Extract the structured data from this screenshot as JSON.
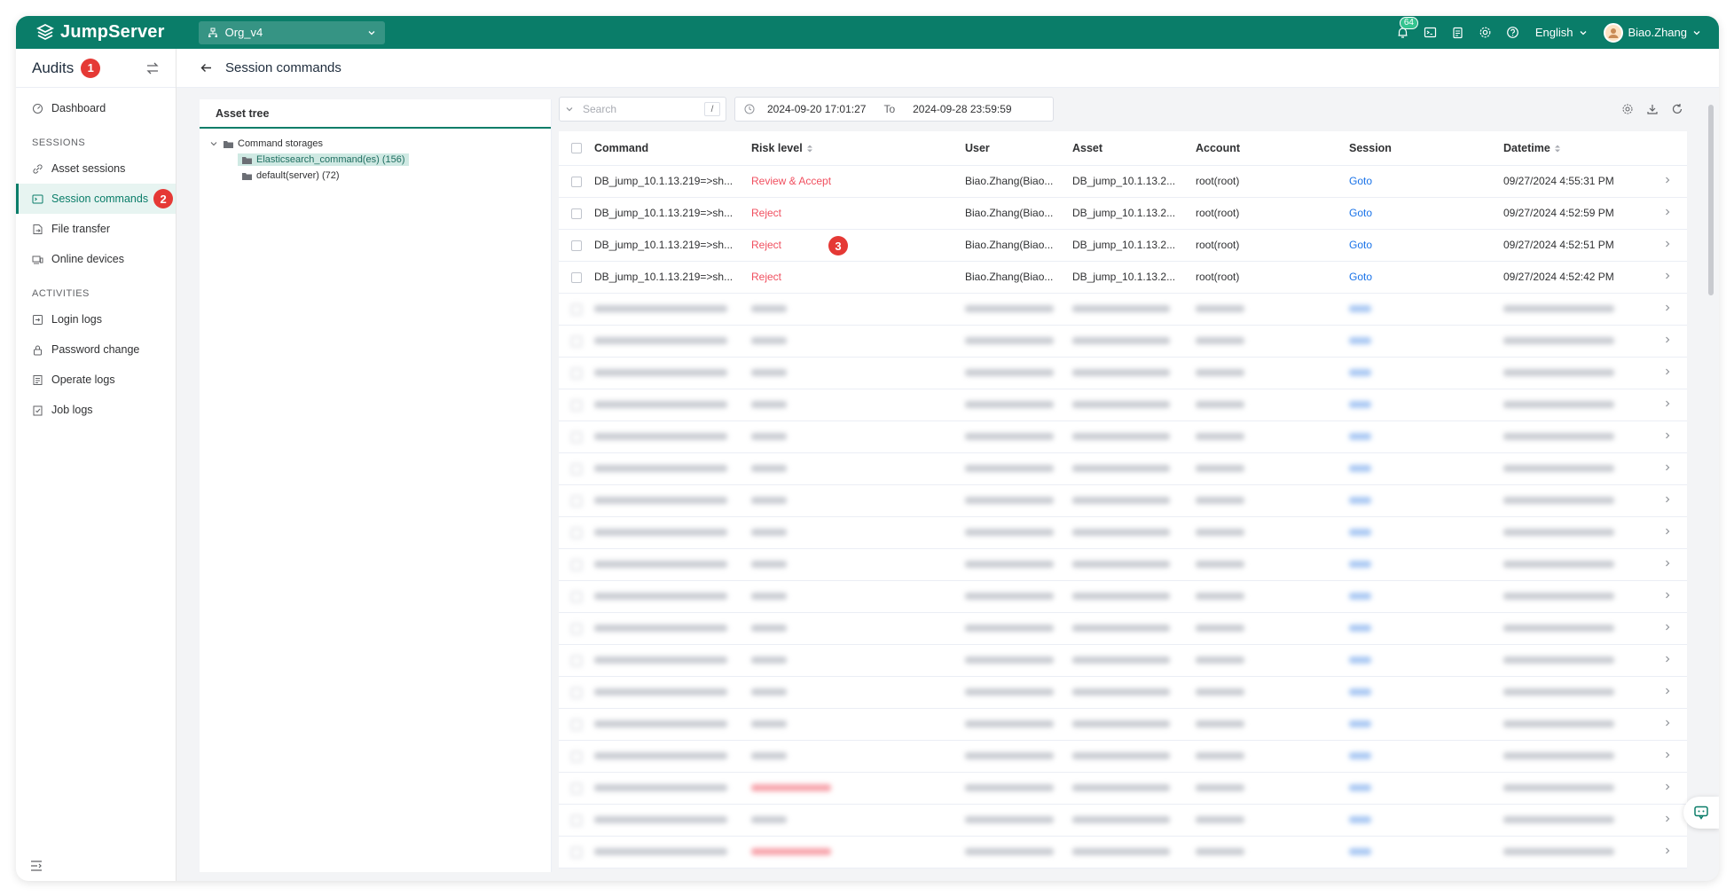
{
  "app": {
    "brand": "JumpServer",
    "org": "Org_v4"
  },
  "header": {
    "notif_count": "64",
    "language": "English",
    "user": "Biao.Zhang"
  },
  "sidebar": {
    "title": "Audits",
    "title_badge": "1",
    "dashboard": "Dashboard",
    "sessions_label": "SESSIONS",
    "asset_sessions": "Asset sessions",
    "session_commands": "Session commands",
    "session_commands_badge": "2",
    "file_transfer": "File transfer",
    "online_devices": "Online devices",
    "activities_label": "ACTIVITIES",
    "login_logs": "Login logs",
    "password_change": "Password change",
    "operate_logs": "Operate logs",
    "job_logs": "Job logs"
  },
  "page": {
    "title": "Session commands"
  },
  "tree": {
    "title": "Asset tree",
    "root": "Command storages",
    "children": [
      "Elasticsearch_command(es) (156)",
      "default(server) (72)"
    ]
  },
  "toolbar": {
    "search_placeholder": "Search",
    "search_kbd": "/",
    "date_from": "2024-09-20 17:01:27",
    "date_to_label": "To",
    "date_to": "2024-09-28 23:59:59"
  },
  "table": {
    "columns": [
      "Command",
      "Risk level",
      "User",
      "Asset",
      "Account",
      "Session",
      "Datetime"
    ],
    "rows": [
      {
        "command": "DB_jump_10.1.13.219=>sh...",
        "risk": "Review & Accept",
        "user": "Biao.Zhang(Biao...",
        "asset": "DB_jump_10.1.13.2...",
        "account": "root(root)",
        "session": "Goto",
        "datetime": "09/27/2024 4:55:31 PM"
      },
      {
        "command": "DB_jump_10.1.13.219=>sh...",
        "risk": "Reject",
        "user": "Biao.Zhang(Biao...",
        "asset": "DB_jump_10.1.13.2...",
        "account": "root(root)",
        "session": "Goto",
        "datetime": "09/27/2024 4:52:59 PM"
      },
      {
        "command": "DB_jump_10.1.13.219=>sh...",
        "risk": "Reject",
        "user": "Biao.Zhang(Biao...",
        "asset": "DB_jump_10.1.13.2...",
        "account": "root(root)",
        "session": "Goto",
        "datetime": "09/27/2024 4:52:51 PM"
      },
      {
        "command": "DB_jump_10.1.13.219=>sh...",
        "risk": "Reject",
        "user": "Biao.Zhang(Biao...",
        "asset": "DB_jump_10.1.13.2...",
        "account": "root(root)",
        "session": "Goto",
        "datetime": "09/27/2024 4:52:42 PM"
      }
    ],
    "annotation_badge": "3"
  },
  "colors": {
    "brand": "#0a7d69",
    "risk": "#f04f5f",
    "link": "#1a73e8",
    "badge": "#e53935"
  }
}
